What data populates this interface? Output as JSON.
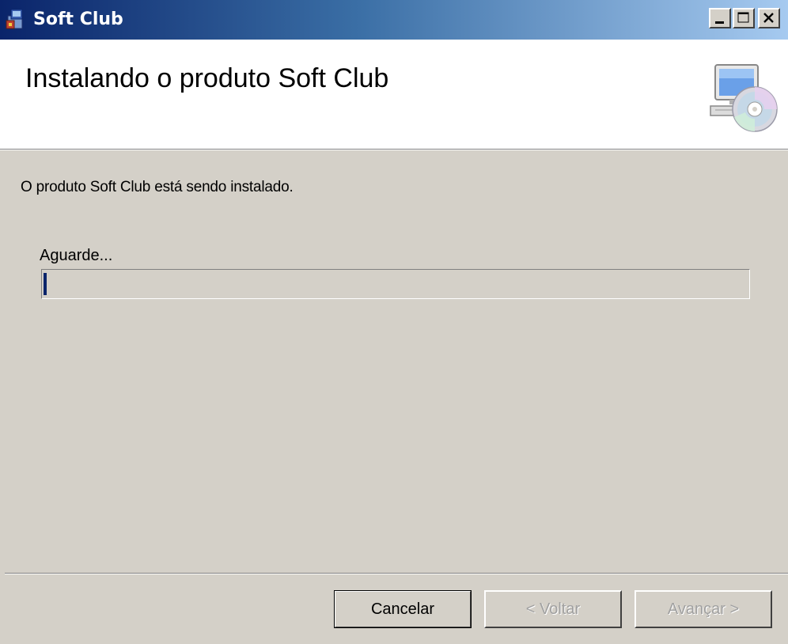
{
  "window": {
    "title": "Soft Club",
    "controls": {
      "minimize": "minimize-icon",
      "maximize": "maximize-icon",
      "close": "close-icon"
    }
  },
  "header": {
    "title": "Instalando o produto Soft Club",
    "icon": "computer-cd-icon"
  },
  "body": {
    "status": "O produto Soft Club está sendo instalado.",
    "progress_label": "Aguarde...",
    "progress_value": 0.005
  },
  "buttons": {
    "cancel": "Cancelar",
    "back": "< Voltar",
    "next": "Avançar >"
  },
  "colors": {
    "titlebar_start": "#0a246a",
    "titlebar_end": "#a6caf0",
    "face": "#d4d0c8",
    "progress_fill": "#0a246a"
  }
}
